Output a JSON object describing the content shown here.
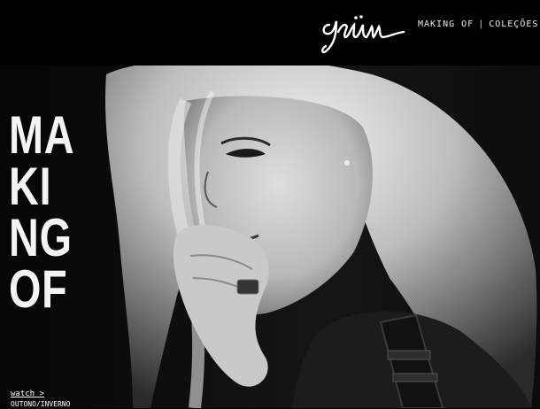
{
  "header": {
    "logo_text": "grüm",
    "nav": [
      {
        "label": "MAKING OF"
      },
      {
        "label": "COLEÇÕES"
      }
    ]
  },
  "hero": {
    "title_lines": [
      "MA",
      "KI",
      "NG",
      "OF"
    ],
    "watch_label": "watch >",
    "watch_sub": "OUTONO/INVERNO"
  }
}
